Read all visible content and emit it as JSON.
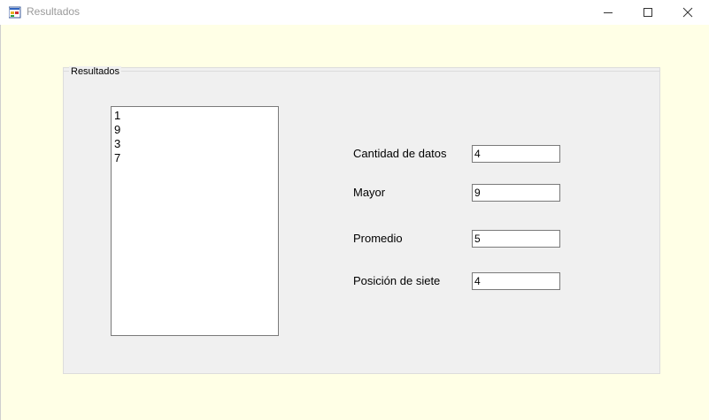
{
  "window": {
    "title": "Resultados",
    "icon": "winforms-app-icon",
    "controls": {
      "minimize": "minimize-icon",
      "maximize": "maximize-icon",
      "close": "close-icon"
    }
  },
  "groupbox": {
    "legend": "Resultados"
  },
  "listbox": {
    "items": [
      "1",
      "9",
      "3",
      "7"
    ]
  },
  "fields": [
    {
      "label": "Cantidad de datos",
      "value": "4"
    },
    {
      "label": "Mayor",
      "value": "9"
    },
    {
      "label": "Promedio",
      "value": "5"
    },
    {
      "label": "Posición de siete",
      "value": "4"
    }
  ]
}
